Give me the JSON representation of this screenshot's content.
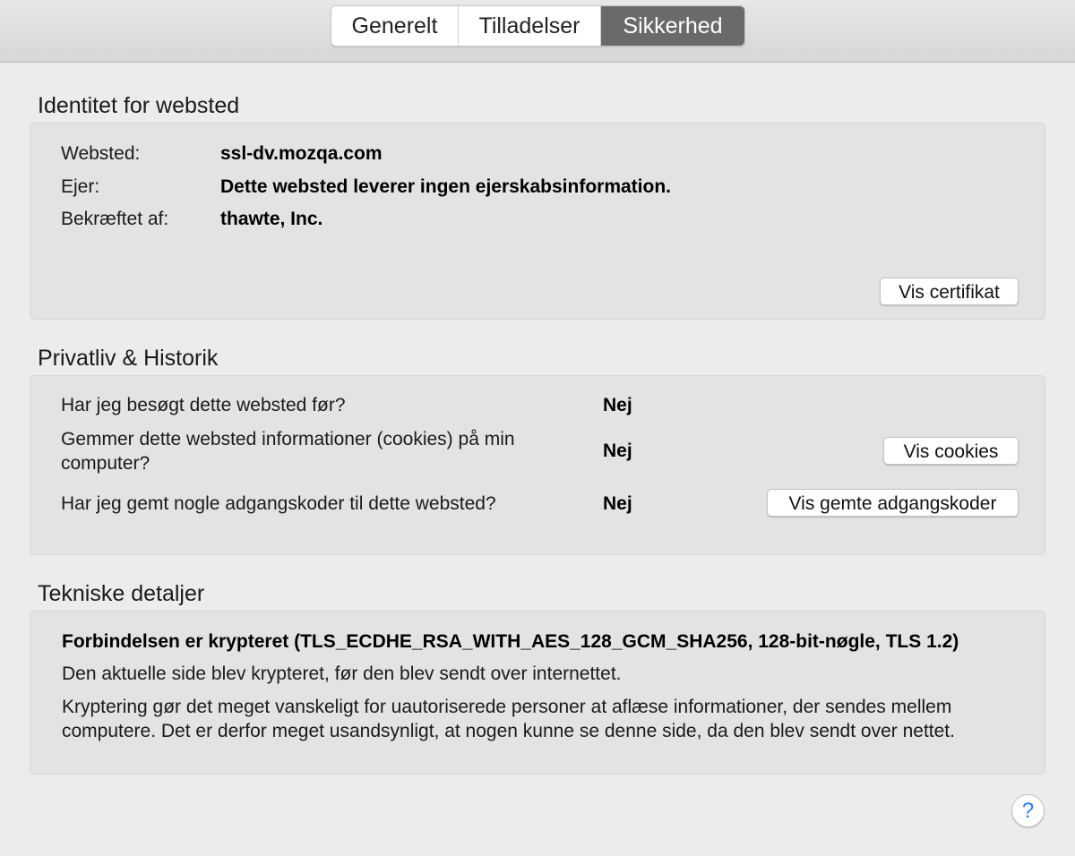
{
  "tabs": [
    {
      "label": "Generelt",
      "active": false
    },
    {
      "label": "Tilladelser",
      "active": false
    },
    {
      "label": "Sikkerhed",
      "active": true
    }
  ],
  "identity": {
    "title": "Identitet for websted",
    "website_label": "Websted:",
    "website_value": "ssl-dv.mozqa.com",
    "owner_label": "Ejer:",
    "owner_value": "Dette websted leverer ingen ejerskabsinformation.",
    "verified_label": "Bekræftet af:",
    "verified_value": "thawte, Inc.",
    "view_cert_button": "Vis certifikat"
  },
  "privacy": {
    "title": "Privatliv & Historik",
    "visited_question": "Har jeg besøgt dette websted før?",
    "visited_answer": "Nej",
    "cookies_question": "Gemmer dette websted informationer (cookies) på min computer?",
    "cookies_answer": "Nej",
    "cookies_button": "Vis cookies",
    "passwords_question": "Har jeg gemt nogle adgangskoder til dette websted?",
    "passwords_answer": "Nej",
    "passwords_button": "Vis gemte adgangskoder"
  },
  "technical": {
    "title": "Tekniske detaljer",
    "heading": "Forbindelsen er krypteret (TLS_ECDHE_RSA_WITH_AES_128_GCM_SHA256, 128-bit-nøgle, TLS 1.2)",
    "line1": "Den aktuelle side blev krypteret, før den blev sendt over internettet.",
    "line2": "Kryptering gør det meget vanskeligt for uautoriserede personer at aflæse informationer, der sendes mellem computere. Det er derfor meget usandsynligt, at nogen kunne se denne side, da den blev sendt over nettet."
  },
  "help": {
    "icon": "help-icon",
    "glyph": "?"
  },
  "colors": {
    "active_tab": "#6a6a6a",
    "panel_bg": "#e3e3e3",
    "window_bg": "#ececec",
    "help_accent": "#2f7be4"
  }
}
